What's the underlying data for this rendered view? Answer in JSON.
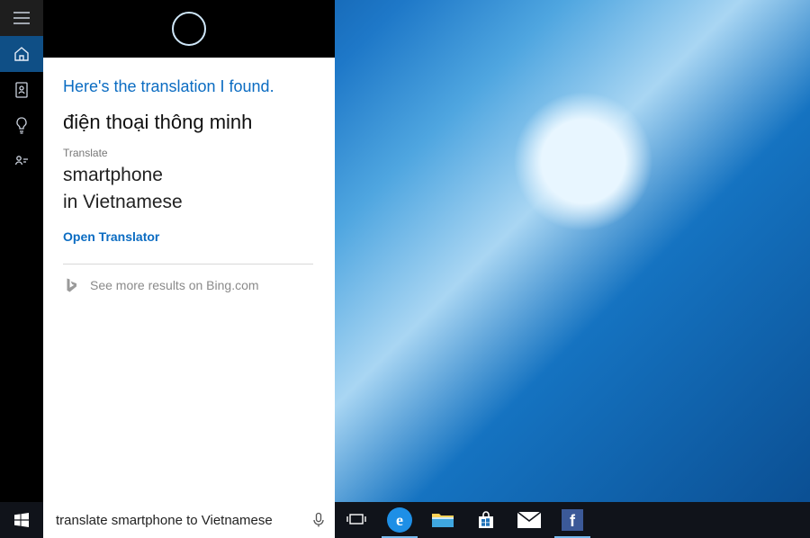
{
  "cortana": {
    "headline": "Here's the translation I found.",
    "translation_result": "điện thoại thông minh",
    "translate_label": "Translate",
    "source_word": "smartphone",
    "target_language_line": "in Vietnamese",
    "open_translator_label": "Open Translator",
    "bing_more_label": "See more results on Bing.com"
  },
  "search": {
    "value": "translate smartphone to Vietnamese"
  },
  "rail_icons": {
    "menu": "menu",
    "home": "home",
    "notebook": "notebook",
    "tips": "tips",
    "feedback": "feedback"
  },
  "taskbar_icons": {
    "task_view": "task-view",
    "edge": "edge",
    "explorer": "file-explorer",
    "store": "store",
    "mail": "mail",
    "facebook": "facebook"
  }
}
